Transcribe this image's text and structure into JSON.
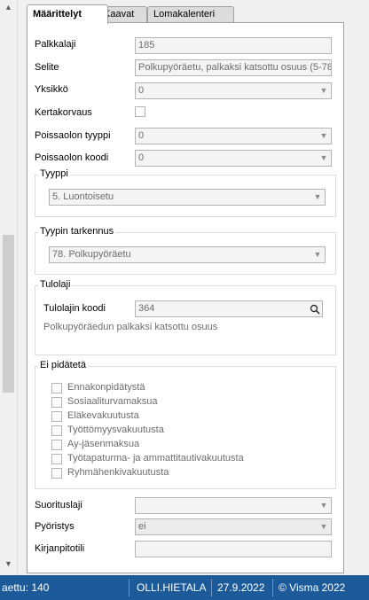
{
  "tabs": [
    {
      "label": "Määrittelyt",
      "active": true
    },
    {
      "label": "Kaavat",
      "active": false
    },
    {
      "label": "Lomakalenteri",
      "active": false
    }
  ],
  "fields": {
    "palkkalaji": {
      "label": "Palkkalaji",
      "value": "185"
    },
    "selite": {
      "label": "Selite",
      "value": "Polkupyöräetu, palkaksi katsottu osuus (5-78"
    },
    "yksikko": {
      "label": "Yksikkö",
      "value": "0"
    },
    "kertakorvaus": {
      "label": "Kertakorvaus",
      "checked": false
    },
    "poissaolon_tyyppi": {
      "label": "Poissaolon tyyppi",
      "value": "0"
    },
    "poissaolon_koodi": {
      "label": "Poissaolon koodi",
      "value": "0"
    }
  },
  "tyyppi": {
    "title": "Tyyppi",
    "value": "5. Luontoisetu"
  },
  "tyypin_tarkennus": {
    "title": "Tyypin tarkennus",
    "value": "78. Polkupyöräetu"
  },
  "tulolaji": {
    "title": "Tulolaji",
    "code_label": "Tulolajin koodi",
    "code_value": "364",
    "description": "Polkupyöräedun palkaksi katsottu osuus"
  },
  "ei_pidateta": {
    "title": "Ei pidätetä",
    "items": [
      {
        "label": "Ennakonpidätystä",
        "checked": false
      },
      {
        "label": "Sosiaaliturvamaksua",
        "checked": false
      },
      {
        "label": "Eläkevakuutusta",
        "checked": false
      },
      {
        "label": "Työttömyysvakuutusta",
        "checked": false
      },
      {
        "label": "Ay-jäsenmaksua",
        "checked": false
      },
      {
        "label": "Työtapaturma- ja ammattitautivakuutusta",
        "checked": false
      },
      {
        "label": "Ryhmähenkivakuutusta",
        "checked": false
      }
    ]
  },
  "bottom_fields": {
    "suorituslaji": {
      "label": "Suorituslaji",
      "value": ""
    },
    "pyoristys": {
      "label": "Pyöristys",
      "value": "ei"
    },
    "kirjanpitotili": {
      "label": "Kirjanpitotili",
      "value": ""
    }
  },
  "status_bar": {
    "count": "aettu: 140",
    "user": "OLLI.HIETALA",
    "date": "27.9.2022",
    "copyright": "© Visma 2022"
  },
  "colors": {
    "status_bg": "#1c5a9a",
    "panel_bg": "#ffffff",
    "window_bg": "#f0f0f0"
  },
  "icons": {
    "scroll_up": "chevron-up-icon",
    "scroll_down": "chevron-down-icon",
    "dropdown": "chevron-down-icon",
    "search": "magnifier-icon"
  }
}
